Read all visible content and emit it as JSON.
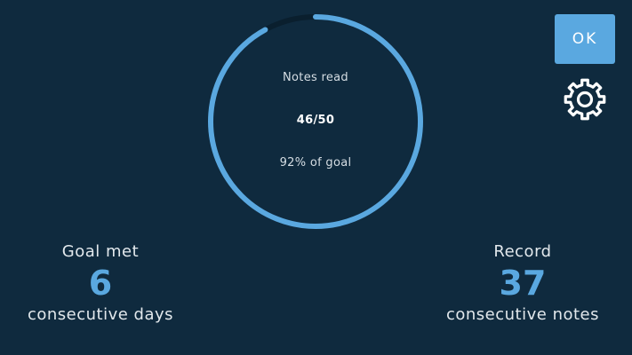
{
  "progress": {
    "title": "Notes read",
    "count": "46/50",
    "percent_text": "92% of goal",
    "fraction": 0.92,
    "color": "#5aa8e0",
    "track_color": "#0a1f2e"
  },
  "buttons": {
    "ok_label": "OK",
    "settings_icon": "gear-icon"
  },
  "stats": {
    "goal": {
      "label": "Goal met",
      "value": "6",
      "caption": "consecutive days"
    },
    "record": {
      "label": "Record",
      "value": "37",
      "caption": "consecutive notes"
    }
  }
}
